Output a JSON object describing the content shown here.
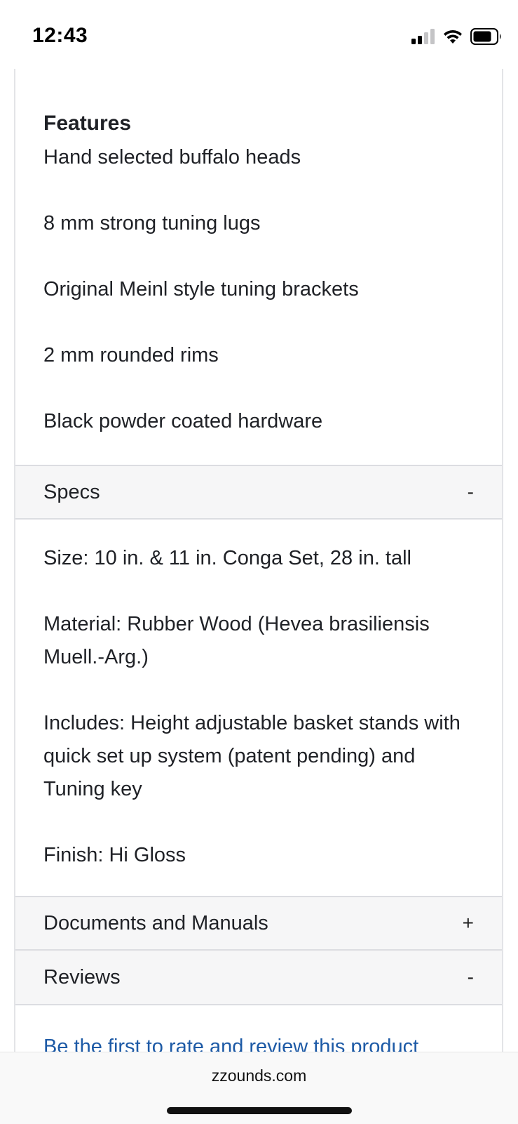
{
  "status_bar": {
    "time": "12:43"
  },
  "features": {
    "title": "Features",
    "items": [
      "Hand selected buffalo heads",
      "8 mm strong tuning lugs",
      "Original Meinl style tuning brackets",
      "2 mm rounded rims",
      "Black powder coated hardware"
    ]
  },
  "specs": {
    "label": "Specs",
    "toggle": "-",
    "items": [
      "Size: 10 in. & 11 in. Conga Set, 28 in. tall",
      "Material: Rubber Wood (Hevea brasiliensis Muell.-Arg.)",
      "Includes: Height adjustable basket stands with quick set up system (patent pending) and Tuning key",
      "Finish: Hi Gloss"
    ]
  },
  "documents": {
    "label": "Documents and Manuals",
    "toggle": "+"
  },
  "reviews": {
    "label": "Reviews",
    "toggle": "-",
    "link_text": "Be the first to rate and review this product"
  },
  "browser": {
    "url": "zzounds.com"
  },
  "colors": {
    "link": "#1d5aa6",
    "header_bg": "#f6f6f7",
    "border": "#dcdde1"
  }
}
